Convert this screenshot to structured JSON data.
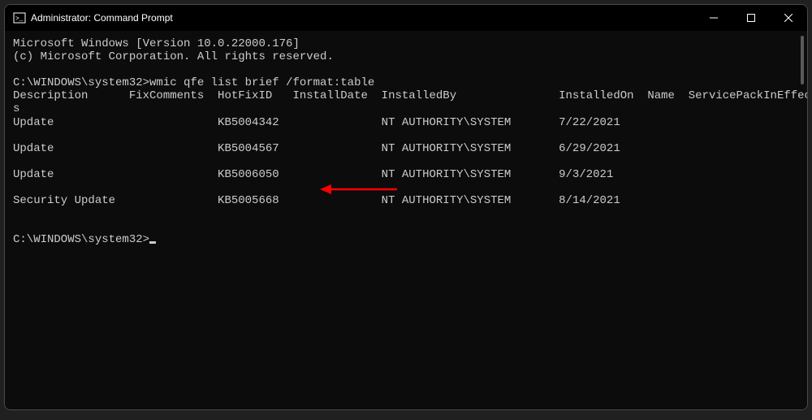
{
  "title": "Administrator: Command Prompt",
  "banner": {
    "line1": "Microsoft Windows [Version 10.0.22000.176]",
    "line2": "(c) Microsoft Corporation. All rights reserved."
  },
  "prompt1": {
    "path": "C:\\WINDOWS\\system32>",
    "command": "wmic qfe list brief /format:table"
  },
  "table": {
    "headers_line1": "Description      FixComments  HotFixID   InstallDate  InstalledBy               InstalledOn  Name  ServicePackInEffect  Statu",
    "headers_line2": "s",
    "rows": [
      {
        "desc": "Update",
        "hotfix": "KB5004342",
        "by": "NT AUTHORITY\\SYSTEM",
        "on": "7/22/2021"
      },
      {
        "desc": "Update",
        "hotfix": "KB5004567",
        "by": "NT AUTHORITY\\SYSTEM",
        "on": "6/29/2021"
      },
      {
        "desc": "Update",
        "hotfix": "KB5006050",
        "by": "NT AUTHORITY\\SYSTEM",
        "on": "9/3/2021"
      },
      {
        "desc": "Security Update",
        "hotfix": "KB5005668",
        "by": "NT AUTHORITY\\SYSTEM",
        "on": "8/14/2021"
      }
    ]
  },
  "prompt2": {
    "path": "C:\\WINDOWS\\system32>"
  },
  "annotation_color": "#ff0000"
}
